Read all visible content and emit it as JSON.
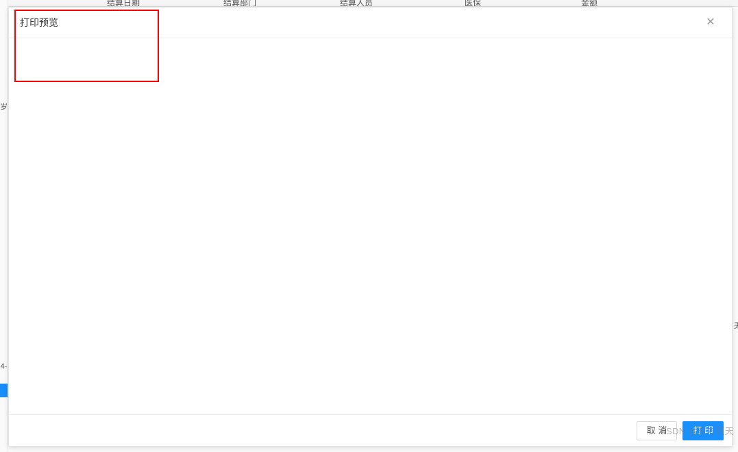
{
  "background": {
    "columns": [
      "",
      "结算日期",
      "结算部门",
      "结算人员",
      "医保",
      "金额"
    ],
    "left_label_1": "岁",
    "left_label_2": "4-",
    "right_label": "无"
  },
  "modal": {
    "title": "打印预览",
    "close_icon_glyph": "✕",
    "footer": {
      "cancel_label": "取 消",
      "confirm_label": "打 印"
    }
  },
  "watermark": "CSDN @东方项天"
}
